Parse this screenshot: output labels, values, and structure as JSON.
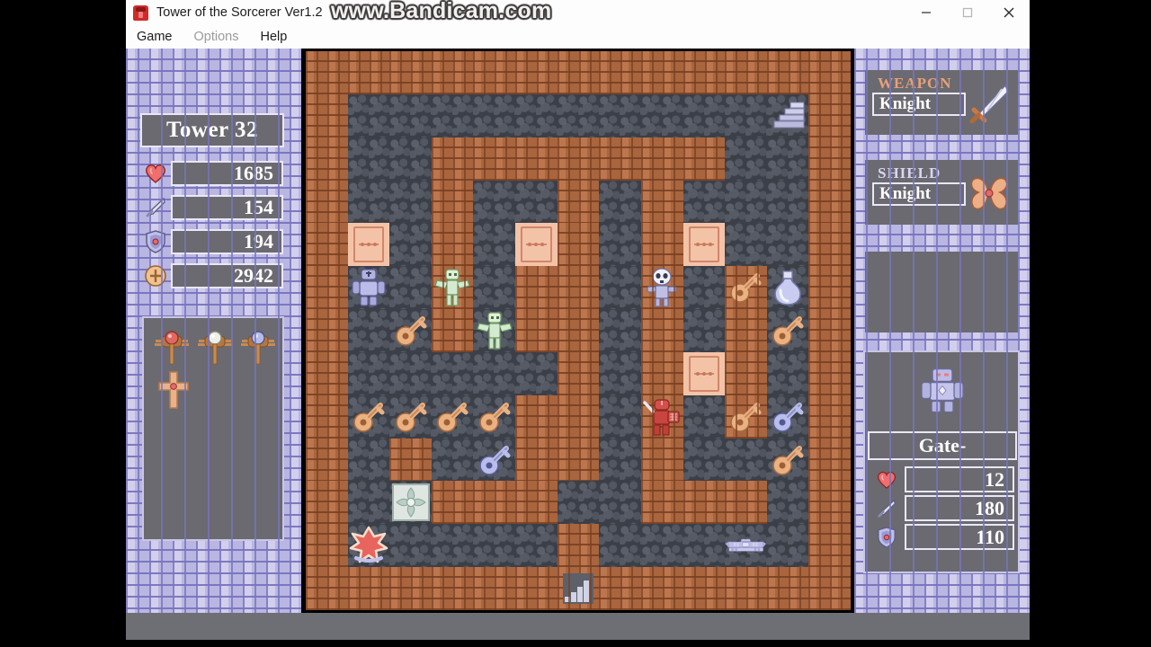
{
  "window": {
    "title": "Tower of the Sorcerer Ver1.2",
    "app_icon": "game-icon",
    "menus": [
      {
        "label": "Game",
        "enabled": true
      },
      {
        "label": "Options",
        "enabled": false
      },
      {
        "label": "Help",
        "enabled": true
      }
    ],
    "controls": {
      "minimize": "minimize-icon",
      "maximize": "maximize-icon",
      "close": "close-icon"
    }
  },
  "watermark": {
    "text": "www.Bandicam.com"
  },
  "hero": {
    "floor_label": "Tower 32",
    "stats": [
      {
        "icon": "heart-icon",
        "name": "hp",
        "value": "1685"
      },
      {
        "icon": "sword-icon",
        "name": "attack",
        "value": "154"
      },
      {
        "icon": "shield-icon",
        "name": "defense",
        "value": "194"
      },
      {
        "icon": "coin-icon",
        "name": "gold",
        "value": "2942"
      }
    ],
    "items": [
      {
        "slot": 0,
        "icon": "red-wing-staff-icon"
      },
      {
        "slot": 1,
        "icon": "white-wing-staff-icon"
      },
      {
        "slot": 2,
        "icon": "blue-wing-staff-icon"
      },
      {
        "slot": 3,
        "icon": "cross-icon"
      }
    ]
  },
  "equipment": [
    {
      "title": "WEAPON",
      "name": "Knight",
      "icon": "sword-item-icon",
      "title_color": "#e8a07a"
    },
    {
      "title": "SHIELD",
      "name": "Knight",
      "icon": "shield-item-icon",
      "title_color": "#d9d6f2"
    }
  ],
  "monster": {
    "portrait": "guard-monster-icon",
    "name": "Gate-",
    "stats": [
      {
        "icon": "heart-icon",
        "name": "hp",
        "value": "12"
      },
      {
        "icon": "sword-icon",
        "name": "attack",
        "value": "180"
      },
      {
        "icon": "shield-icon",
        "name": "defense",
        "value": "110"
      }
    ]
  },
  "colors": {
    "wall": "#a9653e",
    "floor": "#3b3f48",
    "door": "#f3c3a8",
    "panel_stone": "#b9b6e2",
    "readout_bg": "#6a6a70",
    "readout_border": "#e9e7f7",
    "window_chrome": "#fdfdfd"
  },
  "map": {
    "cols": 13,
    "rows": 13,
    "legend": {
      "W": "wall",
      ".": "floor",
      "D": "door"
    },
    "tiles": [
      "WWWWWWWWWWWWW",
      "W...........W",
      "W..WWWWWWW..W",
      "W..W..W.W...W",
      "WD.W.DW.WD..W",
      "W..W.WW.W.W.W",
      "W..W.WW.W.W.W",
      "W.....W.WDW.W",
      "W....WW.W.W.W",
      "W.W..WW.W...W",
      "W..WWW..WWW.W",
      "W.....W.....W",
      "WWWWWWWWWWWWW"
    ],
    "entities": [
      {
        "sprite": "stairs-up-icon",
        "name": "stairs-up",
        "col": 11,
        "row": 1
      },
      {
        "sprite": "guard-monster-icon",
        "name": "guard",
        "col": 1,
        "row": 5
      },
      {
        "sprite": "zombie-icon",
        "name": "zombie",
        "col": 3,
        "row": 5
      },
      {
        "sprite": "yellow-key-icon",
        "name": "yellow-key",
        "col": 2,
        "row": 6
      },
      {
        "sprite": "zombie-icon",
        "name": "zombie",
        "col": 4,
        "row": 6
      },
      {
        "sprite": "skeleton-icon",
        "name": "skeleton",
        "col": 8,
        "row": 5
      },
      {
        "sprite": "yellow-key-icon",
        "name": "yellow-key",
        "col": 10,
        "row": 5
      },
      {
        "sprite": "blue-potion-icon",
        "name": "blue-potion",
        "col": 11,
        "row": 5
      },
      {
        "sprite": "yellow-key-icon",
        "name": "yellow-key",
        "col": 11,
        "row": 6
      },
      {
        "sprite": "yellow-key-icon",
        "name": "yellow-key",
        "col": 1,
        "row": 8
      },
      {
        "sprite": "yellow-key-icon",
        "name": "yellow-key",
        "col": 2,
        "row": 8
      },
      {
        "sprite": "yellow-key-icon",
        "name": "yellow-key",
        "col": 3,
        "row": 8
      },
      {
        "sprite": "yellow-key-icon",
        "name": "yellow-key",
        "col": 4,
        "row": 8
      },
      {
        "sprite": "blue-key-icon",
        "name": "blue-key",
        "col": 4,
        "row": 9
      },
      {
        "sprite": "player-icon",
        "name": "player",
        "col": 8,
        "row": 8
      },
      {
        "sprite": "yellow-key-icon",
        "name": "yellow-key",
        "col": 10,
        "row": 8
      },
      {
        "sprite": "blue-key-icon",
        "name": "blue-key",
        "col": 11,
        "row": 8
      },
      {
        "sprite": "yellow-key-icon",
        "name": "yellow-key",
        "col": 11,
        "row": 9
      },
      {
        "sprite": "fountain-icon",
        "name": "fountain",
        "col": 2,
        "row": 10
      },
      {
        "sprite": "red-gem-icon",
        "name": "red-gem",
        "col": 1,
        "row": 11
      },
      {
        "sprite": "stairs-down-icon",
        "name": "stairs-down",
        "col": 6,
        "row": 12
      },
      {
        "sprite": "altar-icon",
        "name": "altar",
        "col": 10,
        "row": 11
      }
    ]
  }
}
